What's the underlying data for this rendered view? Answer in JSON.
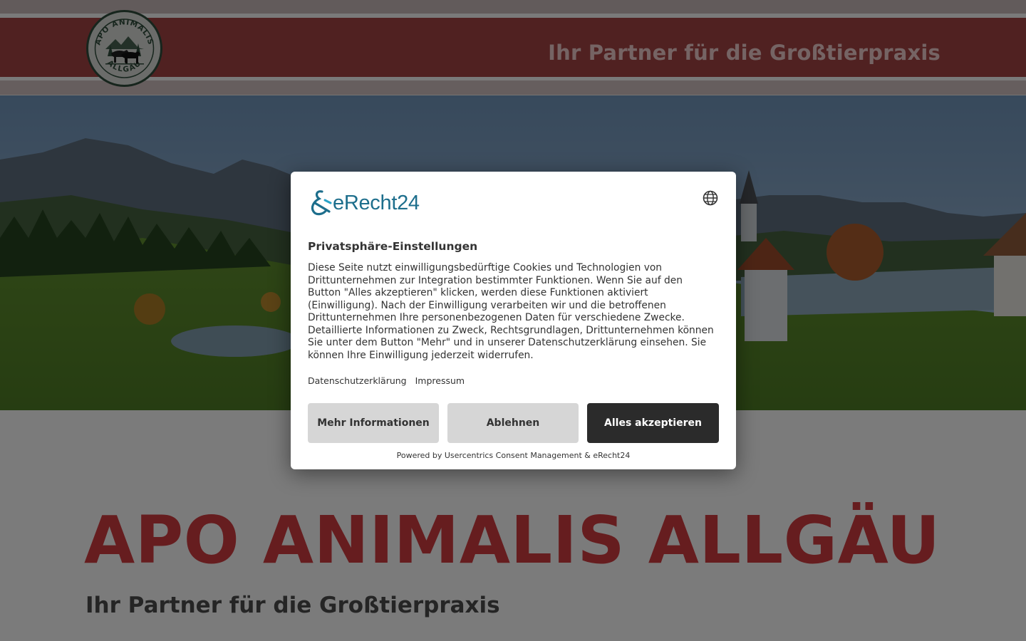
{
  "header": {
    "tagline": "Ihr Partner für die Großtierpraxis",
    "logo": {
      "ring_text_top": "APO ANIMALIS",
      "ring_text_bottom": "ALLGÄU",
      "icon": "cattle-logo-icon"
    }
  },
  "main": {
    "title": "APO ANIMALIS ALLGÄU",
    "subtitle": "Ihr Partner für die Großtierpraxis"
  },
  "consent": {
    "brand": "eRecht24",
    "title": "Privatsphäre-Einstellungen",
    "body": "Diese Seite nutzt einwilligungsbedürftige Cookies und Technologien von Drittunternehmen zur Integration bestimmter Funktionen. Wenn Sie auf den Button \"Alles akzeptieren\" klicken, werden diese Funktionen aktiviert (Einwilligung). Nach der Einwilligung verarbeiten wir und die betroffenen Drittunternehmen Ihre personenbezogenen Daten für verschiedene Zwecke. Detaillierte Informationen zu Zweck, Rechtsgrundlagen, Drittunternehmen können Sie unter dem Button \"Mehr\" und in unserer Datenschutzerklärung einsehen. Sie können Ihre Einwilligung jederzeit widerrufen.",
    "links": [
      "Datenschutzerklärung",
      "Impressum"
    ],
    "buttons": {
      "more": "Mehr Informationen",
      "deny": "Ablehnen",
      "accept": "Alles akzeptieren"
    },
    "powered_by": "Powered by Usercentrics Consent Management & eRecht24",
    "language_icon": "globe-icon"
  },
  "colors": {
    "header_band": "#a04243",
    "title_red": "#cc3b3e",
    "brand_teal": "#1d6e8c",
    "accept_button": "#2b2b2b"
  }
}
